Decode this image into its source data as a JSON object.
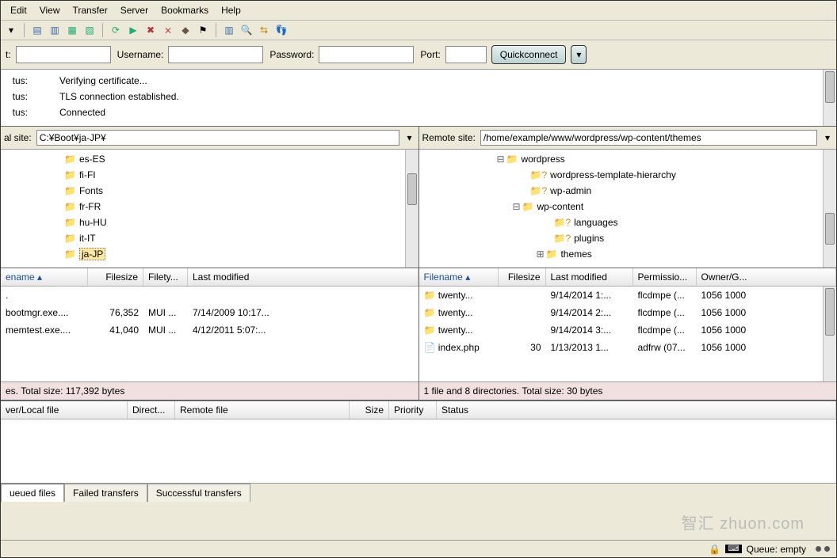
{
  "menu": [
    "Edit",
    "View",
    "Transfer",
    "Server",
    "Bookmarks",
    "Help"
  ],
  "quickbar": {
    "host_label": "t:",
    "user_label": "Username:",
    "pass_label": "Password:",
    "port_label": "Port:",
    "connect": "Quickconnect"
  },
  "log": [
    {
      "label": "tus:",
      "msg": "Verifying certificate..."
    },
    {
      "label": "tus:",
      "msg": "TLS connection established."
    },
    {
      "label": "tus:",
      "msg": "Connected"
    }
  ],
  "local": {
    "label": "al site:",
    "path": "C:¥Boot¥ja-JP¥",
    "tree": [
      {
        "indent": 60,
        "icon": "folder",
        "name": "es-ES"
      },
      {
        "indent": 60,
        "icon": "folder",
        "name": "fi-FI"
      },
      {
        "indent": 60,
        "icon": "folder",
        "name": "Fonts"
      },
      {
        "indent": 60,
        "icon": "folder",
        "name": "fr-FR"
      },
      {
        "indent": 60,
        "icon": "folder",
        "name": "hu-HU"
      },
      {
        "indent": 60,
        "icon": "folder",
        "name": "it-IT"
      },
      {
        "indent": 60,
        "icon": "folder",
        "name": "ja-JP",
        "selected": true
      }
    ],
    "cols": {
      "name": "ename",
      "size": "Filesize",
      "type": "Filety...",
      "modified": "Last modified"
    },
    "files": [
      {
        "name": ".",
        "size": "",
        "type": "",
        "modified": ""
      },
      {
        "name": "bootmgr.exe....",
        "size": "76,352",
        "type": "MUI ...",
        "modified": "7/14/2009 10:17..."
      },
      {
        "name": "memtest.exe....",
        "size": "41,040",
        "type": "MUI ...",
        "modified": "4/12/2011 5:07:..."
      }
    ],
    "summary": "es. Total size: 117,392 bytes"
  },
  "remote": {
    "label": "Remote site:",
    "path": "/home/example/www/wordpress/wp-content/themes",
    "tree": [
      {
        "indent": 90,
        "exp": "minus",
        "icon": "folder",
        "name": "wordpress"
      },
      {
        "indent": 120,
        "icon": "qmark",
        "name": "wordpress-template-hierarchy"
      },
      {
        "indent": 120,
        "icon": "qmark",
        "name": "wp-admin"
      },
      {
        "indent": 110,
        "exp": "minus",
        "icon": "folder",
        "name": "wp-content"
      },
      {
        "indent": 150,
        "icon": "qmark",
        "name": "languages"
      },
      {
        "indent": 150,
        "icon": "qmark",
        "name": "plugins"
      },
      {
        "indent": 140,
        "exp": "plus",
        "icon": "folder",
        "name": "themes"
      }
    ],
    "cols": {
      "name": "Filename",
      "size": "Filesize",
      "modified": "Last modified",
      "perm": "Permissio...",
      "owner": "Owner/G..."
    },
    "files": [
      {
        "icon": "folder",
        "name": "twenty...",
        "size": "",
        "modified": "9/14/2014 1:...",
        "perm": "flcdmpe (...",
        "owner": "1056 1000"
      },
      {
        "icon": "folder",
        "name": "twenty...",
        "size": "",
        "modified": "9/14/2014 2:...",
        "perm": "flcdmpe (...",
        "owner": "1056 1000"
      },
      {
        "icon": "folder",
        "name": "twenty...",
        "size": "",
        "modified": "9/14/2014 3:...",
        "perm": "flcdmpe (...",
        "owner": "1056 1000"
      },
      {
        "icon": "file",
        "name": "index.php",
        "size": "30",
        "modified": "1/13/2013 1...",
        "perm": "adfrw (07...",
        "owner": "1056 1000"
      }
    ],
    "summary": "1 file and 8 directories. Total size: 30 bytes"
  },
  "queue_cols": {
    "server": "ver/Local file",
    "dir": "Direct...",
    "remote": "Remote file",
    "size": "Size",
    "priority": "Priority",
    "status": "Status"
  },
  "tabs": {
    "queued": "ueued files",
    "failed": "Failed transfers",
    "success": "Successful transfers"
  },
  "footer": {
    "queue": "Queue: empty"
  },
  "watermark": "智汇 zhuon.com"
}
